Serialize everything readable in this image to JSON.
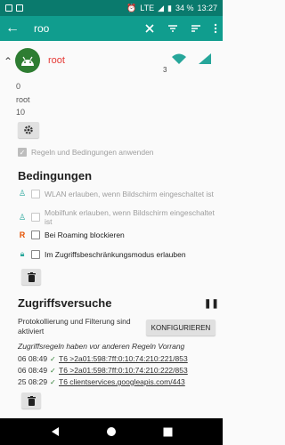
{
  "status_bar": {
    "lte": "LTE",
    "battery": "34 %",
    "time": "13:27"
  },
  "app_bar": {
    "search_value": "roo"
  },
  "app": {
    "name": "root",
    "count": "3"
  },
  "info": {
    "uid": "0",
    "label": "root",
    "value": "10"
  },
  "apply_rules": {
    "label": "Regeln und Bedingungen anwenden"
  },
  "conditions": {
    "title": "Bedingungen",
    "items": [
      {
        "label": "WLAN erlauben, wenn Bildschirm eingeschaltet ist"
      },
      {
        "label": "Mobilfunk erlauben, wenn Bildschirm eingeschaltet ist"
      },
      {
        "label": "Bei Roaming blockieren",
        "icon": "R"
      },
      {
        "label": "Im Zugriffsbeschränkungsmodus erlauben"
      }
    ]
  },
  "access": {
    "title": "Zugriffsversuche",
    "protocol_text": "Protokollierung und Filterung sind aktiviert",
    "configure_label": "KONFIGURIEREN",
    "priority_text": "Zugriffsregeln haben vor anderen Regeln Vorrang",
    "rows": [
      {
        "time": "06 08:49",
        "dest": "T6 >2a01:598:7ff:0:10:74:210:221/853"
      },
      {
        "time": "06 08:49",
        "dest": "T6 >2a01:598:7ff:0:10:74:210:222/853"
      },
      {
        "time": "25 08:29",
        "dest": "T6 clientservices.googleapis.com/443"
      }
    ]
  },
  "colors": {
    "status_bar": "#0a7a6d",
    "app_bar": "#109d8e",
    "app_name": "#e53935",
    "accent_green": "#2e7d32"
  }
}
